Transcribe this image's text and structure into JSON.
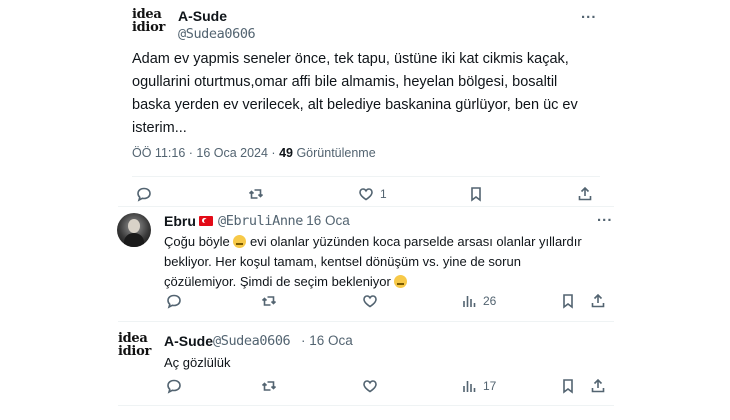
{
  "main_tweet": {
    "avatar_line1": "ide",
    "avatar_line1_b": "a",
    "avatar_line2": "idio",
    "avatar_line2_b": "r",
    "name": "A-Sude",
    "handle": "@Sudea0606",
    "more": "...",
    "text": "Adam ev yapmis seneler önce, tek tapu, üstüne iki kat cikmis kaçak, ogullarini oturtmus,omar affi bile almamis, heyelan bölgesi, bosaltil baska yerden ev verilecek, alt belediye baskanina gürlüyor, ben üc ev isterim...",
    "time": "ÖÖ 11:16 · 16 Oca 2024 · ",
    "views_count": "49",
    "views_label": " Görüntülenme"
  },
  "reply1": {
    "name": "Ebru",
    "handle": "@EbruliAnne",
    "date": "· 16 Oca",
    "more": "...",
    "text_a": "Çoğu böyle ",
    "text_b": " evi olanlar yüzünden koca parselde arsası olanlar yıllardır",
    "text_c": "bekliyor.   Her koşul tamam, kentsel dönüşüm vs. yine de sorun",
    "text_d": "çözülemiyor. Şimdi de seçim bekleniyor ",
    "views": "26"
  },
  "reply2": {
    "avatar_line1": "idea",
    "avatar_line2": "idior",
    "name": "A-Sude",
    "handle": "@Sudea0606",
    "date": "· 16 Oca",
    "text": "Aç gözlülük",
    "views": "17"
  },
  "icons": [
    "reply-icon",
    "retweet-icon",
    "like-icon",
    "views-icon",
    "bookmark-icon",
    "share-icon"
  ]
}
